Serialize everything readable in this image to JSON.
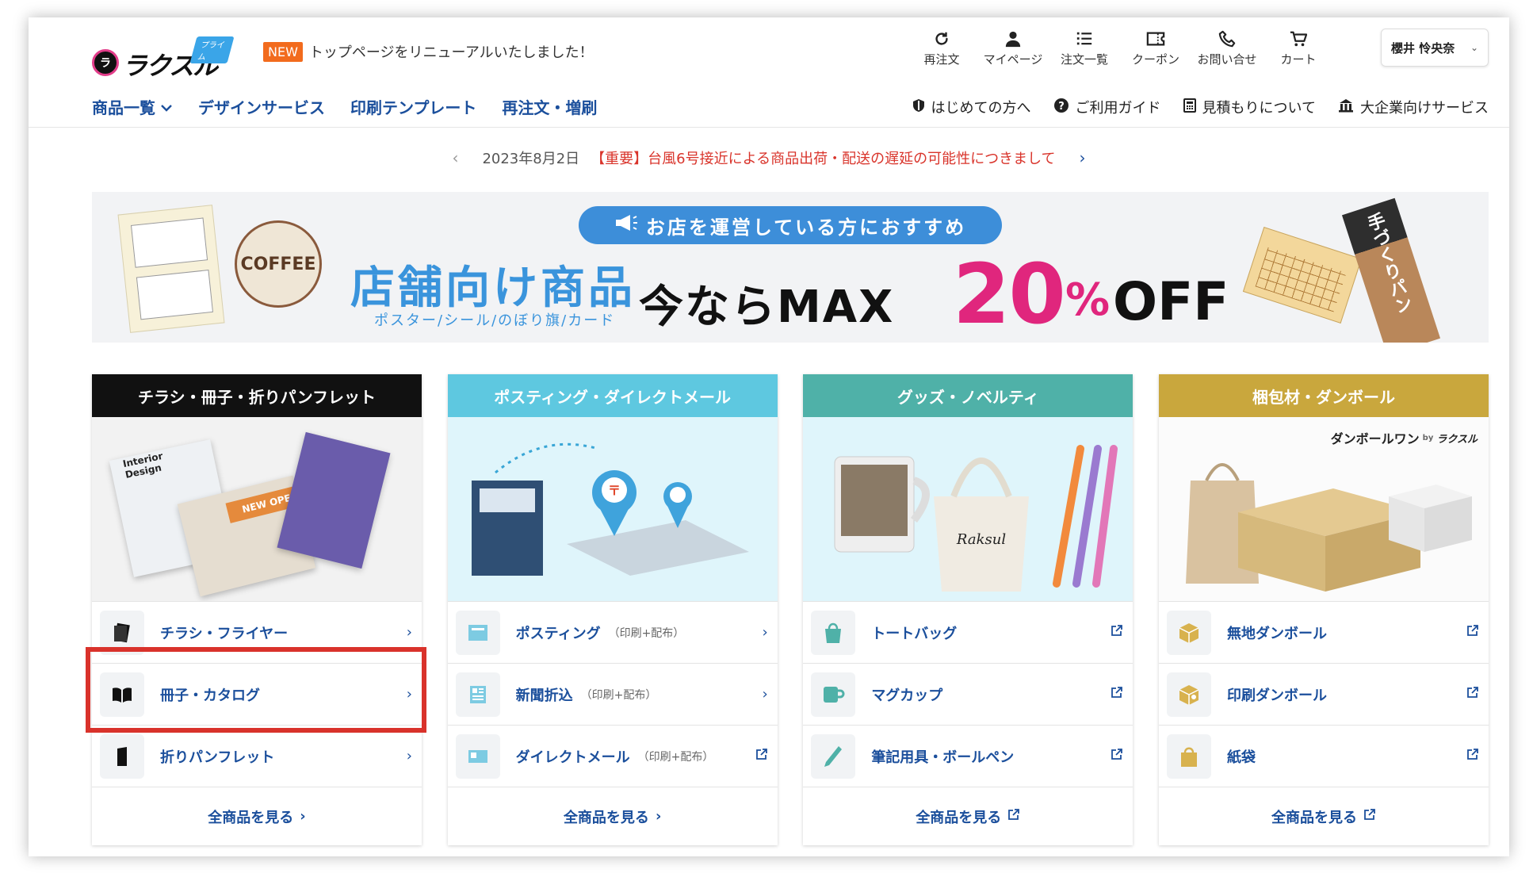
{
  "header": {
    "logo_text": "ラクスル",
    "logo_badge": "プライム",
    "news_badge": "NEW",
    "news_text": "トップページをリニューアルいたしました！",
    "top_icons": [
      {
        "name": "reorder",
        "label": "再注文",
        "icon": "refresh-icon"
      },
      {
        "name": "mypage",
        "label": "マイページ",
        "icon": "user-icon"
      },
      {
        "name": "orders",
        "label": "注文一覧",
        "icon": "list-icon"
      },
      {
        "name": "coupon",
        "label": "クーポン",
        "icon": "ticket-icon"
      },
      {
        "name": "contact",
        "label": "お問い合せ",
        "icon": "phone-icon"
      },
      {
        "name": "cart",
        "label": "カート",
        "icon": "cart-icon"
      }
    ],
    "user_name": "櫻井 怜央奈"
  },
  "nav": {
    "items": [
      {
        "label": "商品一覧",
        "has_dropdown": true
      },
      {
        "label": "デザインサービス"
      },
      {
        "label": "印刷テンプレート"
      },
      {
        "label": "再注文・増刷"
      }
    ],
    "sub_items": [
      {
        "label": "はじめての方へ",
        "icon": "shield-icon"
      },
      {
        "label": "ご利用ガイド",
        "icon": "question-icon"
      },
      {
        "label": "見積もりについて",
        "icon": "calculator-icon"
      },
      {
        "label": "大企業向けサービス",
        "icon": "building-icon"
      }
    ]
  },
  "announcement": {
    "date": "2023年8月2日",
    "message": "【重要】台風6号接近による商品出荷・配送の遅延の可能性につきまして"
  },
  "banner": {
    "pill": "お店を運営している方におすすめ",
    "title": "店舗向け商品",
    "subtitle": "ポスター/シール/のぼり旗/カード",
    "now": "今ならMAX",
    "percent_number": "20",
    "percent_sign": "%",
    "off": "OFF",
    "coffee_text": "COFFEE",
    "flag_text": "手づくりパン"
  },
  "categories": [
    {
      "title": "チラシ・冊子・折りパンフレット",
      "color": "#111111",
      "items": [
        {
          "label": "チラシ・フライヤー",
          "note": "",
          "link_type": "chevron",
          "icon": "flyer-icon"
        },
        {
          "label": "冊子・カタログ",
          "note": "",
          "link_type": "chevron",
          "icon": "book-icon"
        },
        {
          "label": "折りパンフレット",
          "note": "",
          "link_type": "chevron",
          "icon": "folded-pamphlet-icon"
        }
      ],
      "footer": "全商品を見る",
      "footer_link_type": "chevron"
    },
    {
      "title": "ポスティング・ダイレクトメール",
      "color": "#5ec8e0",
      "items": [
        {
          "label": "ポスティング",
          "note": "（印刷+配布）",
          "link_type": "chevron",
          "icon": "mailbox-icon"
        },
        {
          "label": "新聞折込",
          "note": "（印刷+配布）",
          "link_type": "chevron",
          "icon": "newspaper-icon"
        },
        {
          "label": "ダイレクトメール",
          "note": "（印刷+配布）",
          "link_type": "external",
          "icon": "postcard-icon"
        }
      ],
      "footer": "全商品を見る",
      "footer_link_type": "chevron"
    },
    {
      "title": "グッズ・ノベルティ",
      "color": "#4fb1a8",
      "items": [
        {
          "label": "トートバッグ",
          "note": "",
          "link_type": "external",
          "icon": "tote-bag-icon"
        },
        {
          "label": "マグカップ",
          "note": "",
          "link_type": "external",
          "icon": "mug-icon"
        },
        {
          "label": "筆記用具・ボールペン",
          "note": "",
          "link_type": "external",
          "icon": "pen-icon"
        }
      ],
      "footer": "全商品を見る",
      "footer_link_type": "external"
    },
    {
      "title": "梱包材・ダンボール",
      "color": "#c9a73d",
      "items": [
        {
          "label": "無地ダンボール",
          "note": "",
          "link_type": "external",
          "icon": "box-icon"
        },
        {
          "label": "印刷ダンボール",
          "note": "",
          "link_type": "external",
          "icon": "printed-box-icon"
        },
        {
          "label": "紙袋",
          "note": "",
          "link_type": "external",
          "icon": "paper-bag-icon"
        }
      ],
      "footer": "全商品を見る",
      "footer_link_type": "external",
      "brand_text": "ダンボールワン",
      "brand_by": "by",
      "brand_logo": "ラクスル"
    }
  ],
  "illustrations": {
    "flyer_design": "Interior Design",
    "flyer_open": "NEW OPEN",
    "tote_text": "Raksul"
  },
  "colors": {
    "nav_blue": "#1b4f9c",
    "highlight": "#d9322b",
    "banner_pink": "#e0267d",
    "banner_blue": "#3a94dc"
  }
}
